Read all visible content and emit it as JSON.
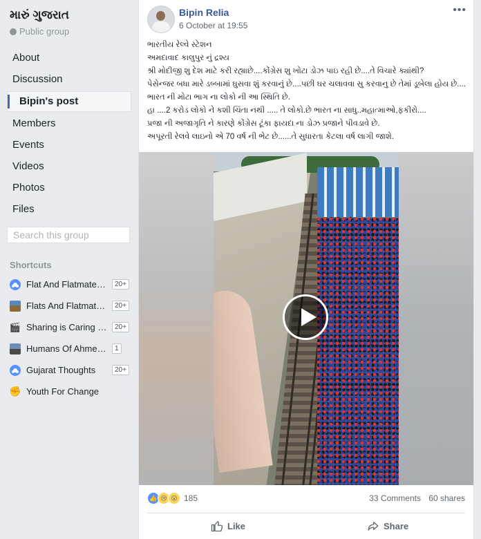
{
  "group": {
    "title": "મારું ગુજરાત",
    "type": "Public group"
  },
  "nav": {
    "items": [
      "About",
      "Discussion",
      "Bipin's post",
      "Members",
      "Events",
      "Videos",
      "Photos",
      "Files"
    ],
    "active": "Bipin's post"
  },
  "search": {
    "placeholder": "Search this group"
  },
  "shortcuts": {
    "title": "Shortcuts",
    "items": [
      {
        "label": "Flat And Flatmates ...",
        "badge": "20+",
        "icon": "group-icon"
      },
      {
        "label": "Flats And Flatmate...",
        "badge": "20+",
        "icon": "group-photo-icon"
      },
      {
        "label": "Sharing is Caring - ...",
        "badge": "20+",
        "icon": "clapperboard-icon"
      },
      {
        "label": "Humans Of Ahmedab...",
        "badge": "1",
        "icon": "group-photo-icon"
      },
      {
        "label": "Gujarat Thoughts",
        "badge": "20+",
        "icon": "group-icon"
      },
      {
        "label": "Youth For Change",
        "badge": "",
        "icon": "raised-fist-icon"
      }
    ]
  },
  "post": {
    "author": "Bipin Relia",
    "timestamp": "6 October at 19:55",
    "lines": [
      "ભારતીય રેલ્વે સ્ટેશન",
      "અમદાવાદ કાલુપુર નું દ્રશ્ય",
      "શ્રી મોદીજી શુ દેશ માટે કરી રહ્યાછે....કોંગ્રેસ શુ ખોટા ડોઝ પાઇ રહી છે....તે વિચારે ક્યાંથી?",
      "પેસેન્જર બધા મારે ડબ્બામાં ઘુસવા શું કરવાનું છે....પછી ઘર ચલાવવા સુ કરવાનુ છે તેમાં ડૂબેલા હોય છે....",
      "ભારત ની મોટા ભાગ ના લોકો ની આ સ્થિતિ છે.",
      "હા ....2 કરોડ લોકો ને કશી ચિંતા નથી ..... તે લોકો.છે ભારત ના સાધુ..મહાત્માઓ,ફકીરો....",
      "પ્રજા ની અજાગૃતિ ને કારણે કોંગ્રેસ ટૂંકા ફાયદા ના ડોઝ પ્રજાને પીવડાવે છે.",
      "અપૂરતી રેલવે લાઇનો એ 70 વર્ષ ની ભેટ છે......તે સુધારતા કેટલા વર્ષ લાગી જાશે."
    ],
    "reactions_count": "185",
    "comments": "33 Comments",
    "shares": "60 shares",
    "actions": {
      "like": "Like",
      "share": "Share"
    }
  },
  "colors": {
    "page_bg": "#e9ebee",
    "link_blue": "#385898",
    "accent": "#4267b2",
    "secondary_text": "#606770"
  }
}
